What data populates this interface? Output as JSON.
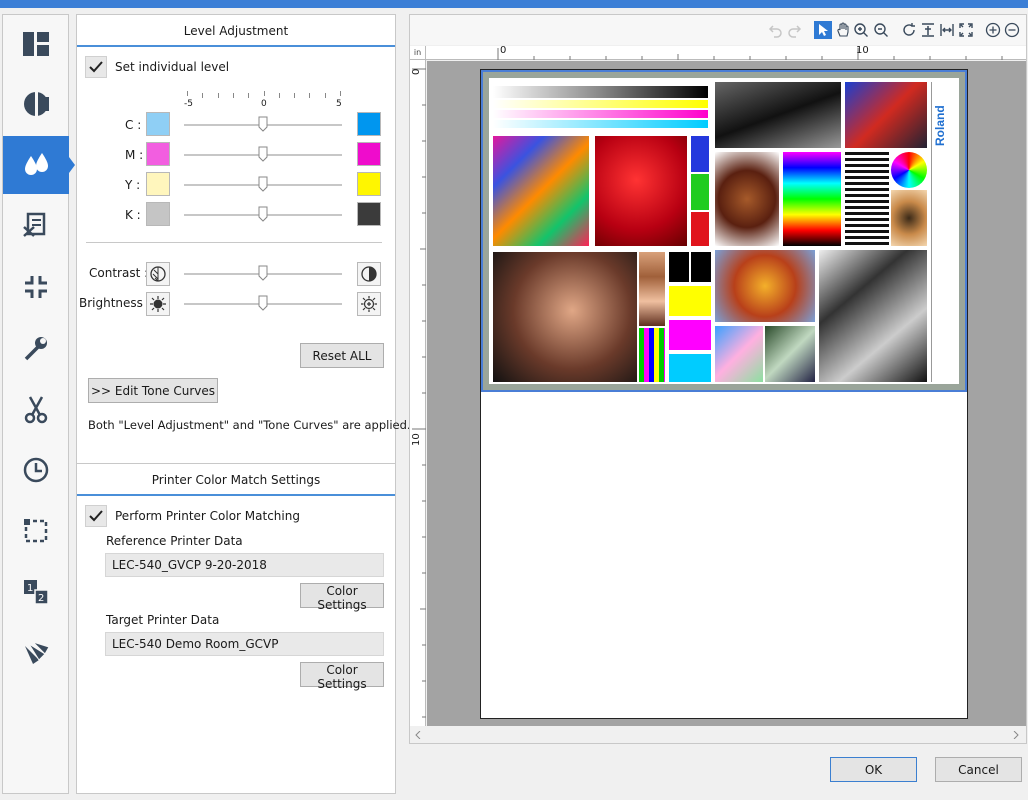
{
  "sidebar": {
    "items": [
      {
        "name": "layout-icon"
      },
      {
        "name": "color-drop-half-icon"
      },
      {
        "name": "ink-drops-icon",
        "active": true
      },
      {
        "name": "print-cut-icon"
      },
      {
        "name": "shrink-icon"
      },
      {
        "name": "wrench-icon"
      },
      {
        "name": "scissors-icon"
      },
      {
        "name": "clock-icon"
      },
      {
        "name": "crop-marks-icon"
      },
      {
        "name": "page-order-icon"
      },
      {
        "name": "color-swatch-fan-icon"
      }
    ]
  },
  "level_adjustment": {
    "title": "Level Adjustment",
    "set_individual_label": "Set individual level",
    "scale": [
      "-5",
      "0",
      "5"
    ],
    "channels": [
      {
        "label": "C :",
        "light": "#8fcff5",
        "dark": "#0096ef",
        "value": 0
      },
      {
        "label": "M :",
        "light": "#f25ee0",
        "dark": "#ef0ccc",
        "value": 0
      },
      {
        "label": "Y :",
        "light": "#fff6bd",
        "dark": "#fff600",
        "value": 0
      },
      {
        "label": "K :",
        "light": "#c5c5c5",
        "dark": "#3b3b3b",
        "value": 0
      }
    ],
    "contrast_label": "Contrast :",
    "brightness_label": "Brightness :",
    "contrast_value": 0,
    "brightness_value": 0,
    "reset_all": "Reset ALL",
    "edit_tone_curves": ">> Edit Tone Curves",
    "note": "Both \"Level Adjustment\" and \"Tone Curves\" are applied."
  },
  "color_match": {
    "title": "Printer Color Match Settings",
    "perform_label": "Perform Printer Color Matching",
    "reference_label": "Reference Printer Data",
    "reference_value": "LEC-540_GVCP 9-20-2018",
    "target_label": "Target Printer Data",
    "target_value": "LEC-540 Demo Room_GCVP",
    "color_settings": "Color Settings"
  },
  "preview": {
    "ruler_unit": "in",
    "ruler_h_labels": [
      "0",
      "10"
    ],
    "ruler_v_labels": [
      "0",
      "10"
    ],
    "brand": "Roland"
  },
  "footer": {
    "ok": "OK",
    "cancel": "Cancel"
  }
}
